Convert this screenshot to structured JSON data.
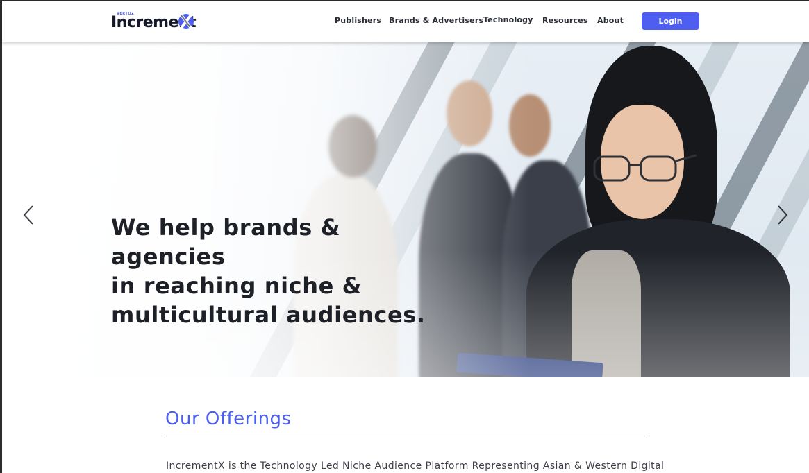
{
  "brand": {
    "logo_small": "VERTOZ",
    "logo_main": "Increment",
    "logo_x": "X",
    "accent": "#4d5ef0"
  },
  "nav": {
    "items": [
      {
        "label": "Publishers"
      },
      {
        "label": "Brands & Advertisers"
      },
      {
        "label": "Technology"
      },
      {
        "label": "Resources"
      },
      {
        "label": "About"
      }
    ],
    "login_label": "Login"
  },
  "hero": {
    "headline": "We help brands & agencies\nin reaching niche &\nmulticultural audiences.",
    "prev_icon": "chevron-left-icon",
    "next_icon": "chevron-right-icon"
  },
  "offerings": {
    "title": "Our Offerings",
    "text": "IncrementX is the Technology Led Niche Audience Platform Representing Asian & Western Digital"
  }
}
